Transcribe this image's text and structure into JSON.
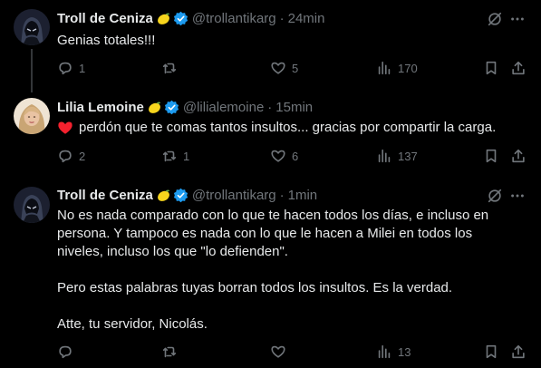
{
  "tweets": [
    {
      "name": "Troll de Ceniza",
      "handle": "@trollantikarg",
      "time": "24min",
      "text": [
        "Genias totales!!!"
      ],
      "replies": "1",
      "reposts": "",
      "likes": "5",
      "views": "170"
    },
    {
      "name": "Lilia Lemoine",
      "handle": "@lilialemoine",
      "time": "15min",
      "text": [
        "perdón que te comas tantos insultos... gracias por compartir la carga."
      ],
      "replies": "2",
      "reposts": "1",
      "likes": "6",
      "views": "137"
    },
    {
      "name": "Troll de Ceniza",
      "handle": "@trollantikarg",
      "time": "1min",
      "text": [
        "No es nada comparado con lo que te hacen todos los días, e incluso en",
        "persona. Y tampoco es nada con lo que le hacen a Milei en todos los",
        "niveles, incluso los que \"lo defienden\".",
        "Pero estas palabras tuyas borran todos los insultos. Es la verdad.",
        "Atte, tu servidor, Nicolás."
      ],
      "replies": "",
      "reposts": "",
      "likes": "",
      "views": "13"
    }
  ],
  "icons": {
    "emoji": "lemon-emoji",
    "verified": "verified-badge-icon",
    "heart_emoji": "red-heart-emoji",
    "grok": "grok-icon",
    "more": "more-icon",
    "reply": "reply-icon",
    "repost": "repost-icon",
    "like": "like-icon",
    "views": "views-icon",
    "bookmark": "bookmark-icon",
    "share": "share-icon"
  },
  "colors": {
    "background": "#000000",
    "text": "#e7e9ea",
    "muted": "#71767b",
    "verified": "#1d9bf0",
    "heart": "#f4212e",
    "lemon": "#f7d51d"
  }
}
